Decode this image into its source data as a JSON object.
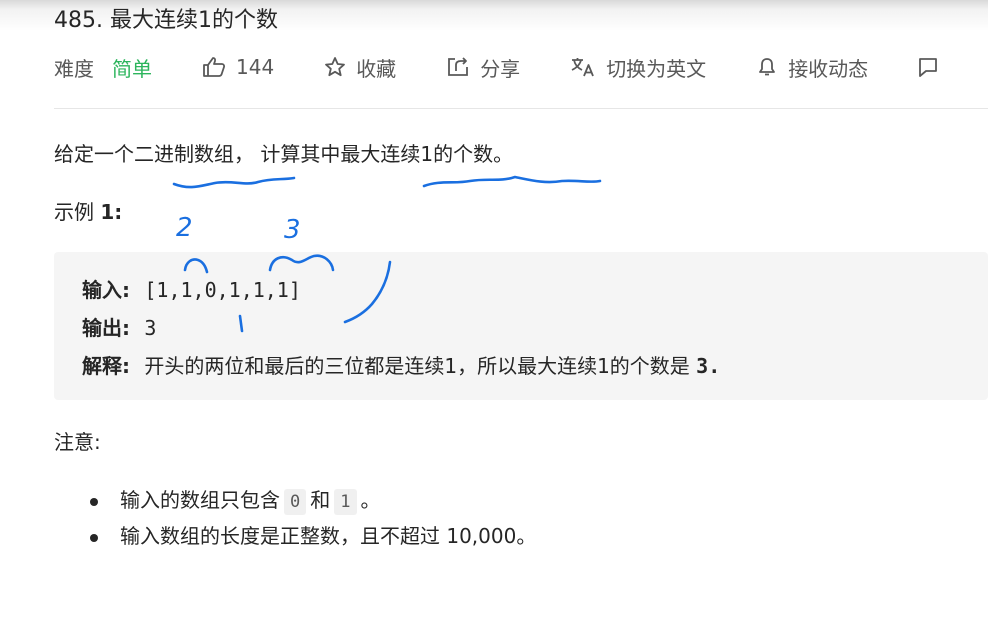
{
  "problem": {
    "title": "485. 最大连续1的个数",
    "difficulty_label": "难度",
    "difficulty_value": "简单",
    "like_count": "144",
    "favorite_label": "收藏",
    "share_label": "分享",
    "switch_lang_label": "切换为英文",
    "subscribe_label": "接收动态"
  },
  "colors": {
    "difficulty_easy": "#2db55d",
    "annotation_ink": "#1a6fe0"
  },
  "icons": [
    "thumbs-up-icon",
    "star-icon",
    "share-icon",
    "translate-icon",
    "bell-icon",
    "feedback-icon"
  ],
  "description": "给定一个二进制数组， 计算其中最大连续1的个数。",
  "example": {
    "title_prefix": "示例 ",
    "title_number": "1:",
    "input_label": "输入:",
    "input_value": "[1,1,0,1,1,1]",
    "output_label": "输出:",
    "output_value": "3",
    "explain_label": "解释:",
    "explain_text": "开头的两位和最后的三位都是连续1，所以最大连续1的个数是 ",
    "explain_value": "3."
  },
  "notes": {
    "title": "注意:",
    "item1_prefix": "输入的数组只包含",
    "item1_code1": "0",
    "item1_mid": "和",
    "item1_code2": "1",
    "item1_suffix": "。",
    "item2": "输入数组的长度是正整数，且不超过 10,000。"
  },
  "handwriting": {
    "mark_2": "2",
    "mark_3": "3"
  }
}
